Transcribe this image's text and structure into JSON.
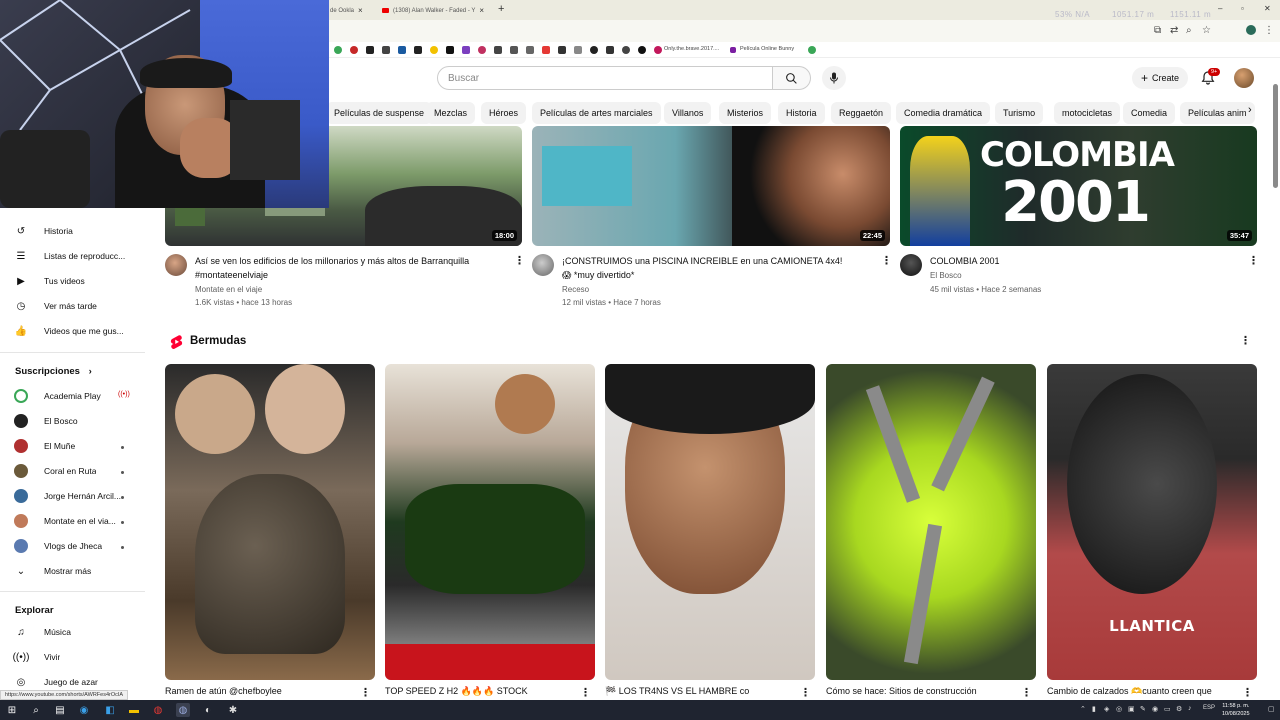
{
  "browser": {
    "tabs": [
      {
        "label": "de Ookla"
      },
      {
        "label": "(1308) Alan Walker - Faded - Y"
      }
    ],
    "perf_overlay": [
      "53% N/A",
      "1051.17 m",
      "1151.11 m"
    ],
    "bookmarks": [
      {
        "label": "Only.the.brave.2017...."
      },
      {
        "label": "Película Online Bunny"
      }
    ],
    "status_url": "https://www.youtube.com/shorts/AWRFes4rOcIA"
  },
  "header": {
    "search_placeholder": "Buscar",
    "create_label": "Create",
    "notif_badge": "9+"
  },
  "chips": [
    "Películas de suspense",
    "Mezclas",
    "Héroes",
    "Películas de artes marciales",
    "Villanos",
    "Misterios",
    "Historia",
    "Reggaetón",
    "Comedia dramática",
    "Turismo",
    "motocicletas",
    "Comedia",
    "Películas anim"
  ],
  "sidebar": {
    "you_items": [
      {
        "label": "Historia",
        "icon": "history-icon"
      },
      {
        "label": "Listas de reproducc...",
        "icon": "playlist-icon"
      },
      {
        "label": "Tus videos",
        "icon": "your-videos-icon"
      },
      {
        "label": "Ver más tarde",
        "icon": "watch-later-icon"
      },
      {
        "label": "Videos que me gus...",
        "icon": "like-icon"
      }
    ],
    "subs_title": "Suscripciones",
    "subscriptions": [
      {
        "label": "Academia Play",
        "color": "#3aa757"
      },
      {
        "label": "El Bosco",
        "color": "#222222"
      },
      {
        "label": "El Muñe",
        "color": "#b03030"
      },
      {
        "label": "Coral en Ruta",
        "color": "#6b5a3a"
      },
      {
        "label": "Jorge Hernán Arcil...",
        "color": "#3a6b9a"
      },
      {
        "label": "Montate en el via...",
        "color": "#c07a5a"
      },
      {
        "label": "Vlogs de Jheca",
        "color": "#5a7ab0"
      }
    ],
    "show_more": "Mostrar más",
    "explore_title": "Explorar",
    "explore": [
      {
        "label": "Música",
        "icon": "music-icon"
      },
      {
        "label": "Vivir",
        "icon": "live-icon"
      },
      {
        "label": "Juego de azar",
        "icon": "gaming-icon"
      }
    ]
  },
  "videos": [
    {
      "duration": "18:00",
      "title_1": "Así se ven los edificios de los millonarios y más altos de Barranquilla",
      "title_2": "#montateenelviaje",
      "channel": "Montate en el viaje",
      "meta": "1.6K vistas • hace 13 horas"
    },
    {
      "duration": "22:45",
      "title_1": "¡CONSTRUIMOS una PISCINA INCREIBLE en una CAMIONETA 4x4!",
      "title_2": "😱 *muy divertido*",
      "channel": "Receso",
      "meta": "12 mil vistas • Hace 7 horas"
    },
    {
      "duration": "35:47",
      "title_1": "COLOMBIA 2001",
      "title_2": "",
      "channel": "El Bosco",
      "meta": "45 mil vistas • Hace 2 semanas",
      "thumb_text_1": "COLOMBIA",
      "thumb_text_2": "2001"
    }
  ],
  "shorts": {
    "section_title": "Bermudas",
    "items": [
      {
        "title": "Ramen de atún @chefboylee"
      },
      {
        "title": "TOP SPEED Z H2 🔥🔥🔥 STOCK"
      },
      {
        "title": "🏁 LOS TR4NS VS EL HAMBRE co"
      },
      {
        "title": "Cómo se hace: Sitios de construcción"
      },
      {
        "title": "Cambio de calzados 🫶cuanto creen que",
        "thumb_text": "LLANTICA"
      }
    ]
  },
  "taskbar": {
    "lang": "ESP",
    "time": "11:58 p. m.",
    "date": "10/08/2025"
  }
}
